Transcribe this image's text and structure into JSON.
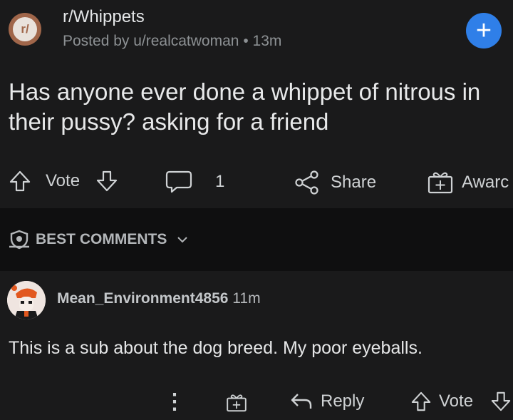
{
  "post": {
    "subreddit": "r/Whippets",
    "subreddit_icon_text": "r/",
    "posted_by": "Posted by u/realcatwoman",
    "separator": "•",
    "age": "13m",
    "join_symbol": "+",
    "title": "Has anyone ever done a whippet of nitrous in their pussy? asking for a friend",
    "actions": {
      "vote_label": "Vote",
      "comment_count": "1",
      "share_label": "Share",
      "award_label": "Awarc"
    }
  },
  "sort": {
    "label": "BEST COMMENTS"
  },
  "comment": {
    "username": "Mean_Environment4856",
    "age": "11m",
    "body": "This is a sub about the dog breed. My poor eyeballs.",
    "actions": {
      "more_symbol": "⋮",
      "reply_label": "Reply",
      "vote_label": "Vote"
    }
  },
  "colors": {
    "background": "#1a1a1b",
    "divider_background": "#0f0f10",
    "join_button": "#2f7fe8",
    "subreddit_icon": "#a0664a",
    "text_primary": "#e8e9ea",
    "text_secondary": "#8d9194"
  },
  "icons": [
    "subreddit-icon",
    "plus-icon",
    "upvote-icon",
    "downvote-icon",
    "comment-icon",
    "share-icon",
    "award-icon",
    "shield-icon",
    "chevron-down-icon",
    "avatar",
    "more-icon",
    "reply-icon"
  ]
}
